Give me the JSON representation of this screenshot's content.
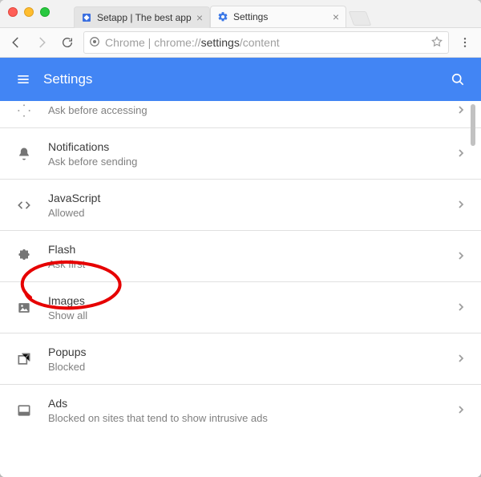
{
  "window": {
    "traffic_lights": [
      "close",
      "minimize",
      "maximize"
    ]
  },
  "tabs": [
    {
      "label": "Setapp | The best app",
      "active": false,
      "icon": "setapp"
    },
    {
      "label": "Settings",
      "active": true,
      "icon": "gear"
    }
  ],
  "toolbar": {
    "scheme_icon_name": "chrome-page-icon",
    "url_scheme_label": "Chrome",
    "url_divider": " | ",
    "url_host_pre": "chrome://",
    "url_host_strong": "settings",
    "url_path": "/content"
  },
  "header": {
    "title": "Settings"
  },
  "content_rows": [
    {
      "key": "location",
      "icon": "location",
      "title": "",
      "sub": "Ask before accessing"
    },
    {
      "key": "notifications",
      "icon": "bell",
      "title": "Notifications",
      "sub": "Ask before sending"
    },
    {
      "key": "javascript",
      "icon": "code",
      "title": "JavaScript",
      "sub": "Allowed"
    },
    {
      "key": "flash",
      "icon": "puzzle",
      "title": "Flash",
      "sub": "Ask first"
    },
    {
      "key": "images",
      "icon": "image",
      "title": "Images",
      "sub": "Show all"
    },
    {
      "key": "popups",
      "icon": "popup",
      "title": "Popups",
      "sub": "Blocked"
    },
    {
      "key": "ads",
      "icon": "ad-frame",
      "title": "Ads",
      "sub": "Blocked on sites that tend to show intrusive ads"
    }
  ],
  "annotation": {
    "target_key": "flash",
    "color": "#e60000"
  }
}
